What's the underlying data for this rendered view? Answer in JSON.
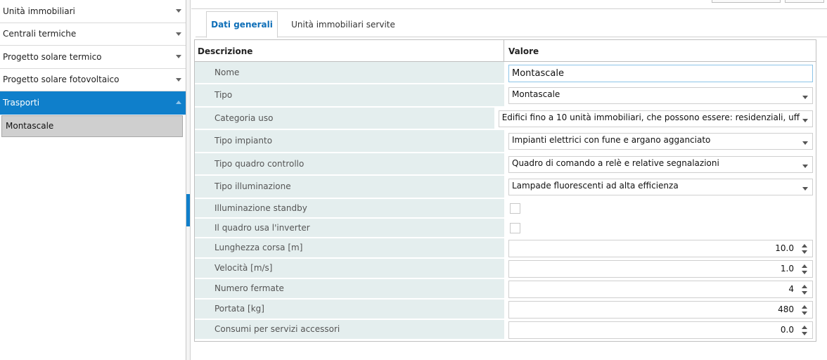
{
  "sidebar": {
    "items": [
      {
        "label": "Unità immobiliari"
      },
      {
        "label": "Centrali termiche"
      },
      {
        "label": "Progetto solare termico"
      },
      {
        "label": "Progetto solare fotovoltaico"
      },
      {
        "label": "Trasporti"
      }
    ],
    "subitem": "Montascale"
  },
  "tabs": [
    {
      "label": "Dati generali"
    },
    {
      "label": "Unità immobiliari servite"
    }
  ],
  "grid": {
    "header": {
      "col1": "Descrizione",
      "col2": "Valore"
    },
    "rows": {
      "nome": {
        "label": "Nome",
        "value": "Montascale"
      },
      "tipo": {
        "label": "Tipo",
        "value": "Montascale"
      },
      "categoria": {
        "label": "Categoria uso",
        "value": "Edifici fino a 10 unità immobiliari, che possono essere: residenziali, uff"
      },
      "tipo_impianto": {
        "label": "Tipo impianto",
        "value": "Impianti elettrici con fune e argano agganciato"
      },
      "quadro": {
        "label": "Tipo quadro controllo",
        "value": "Quadro di comando a relè e relative segnalazioni"
      },
      "illuminazione": {
        "label": "Tipo illuminazione",
        "value": "Lampade fluorescenti ad alta efficienza"
      },
      "standby": {
        "label": "Illuminazione standby",
        "checked": false
      },
      "inverter": {
        "label": "Il quadro usa l'inverter",
        "checked": false
      },
      "lunghezza": {
        "label": "Lunghezza corsa [m]",
        "value": "10.0"
      },
      "velocita": {
        "label": "Velocità [m/s]",
        "value": "1.0"
      },
      "fermate": {
        "label": "Numero fermate",
        "value": "4"
      },
      "portata": {
        "label": "Portata [kg]",
        "value": "480"
      },
      "consumi": {
        "label": "Consumi per servizi accessori",
        "value": "0.0"
      }
    }
  }
}
